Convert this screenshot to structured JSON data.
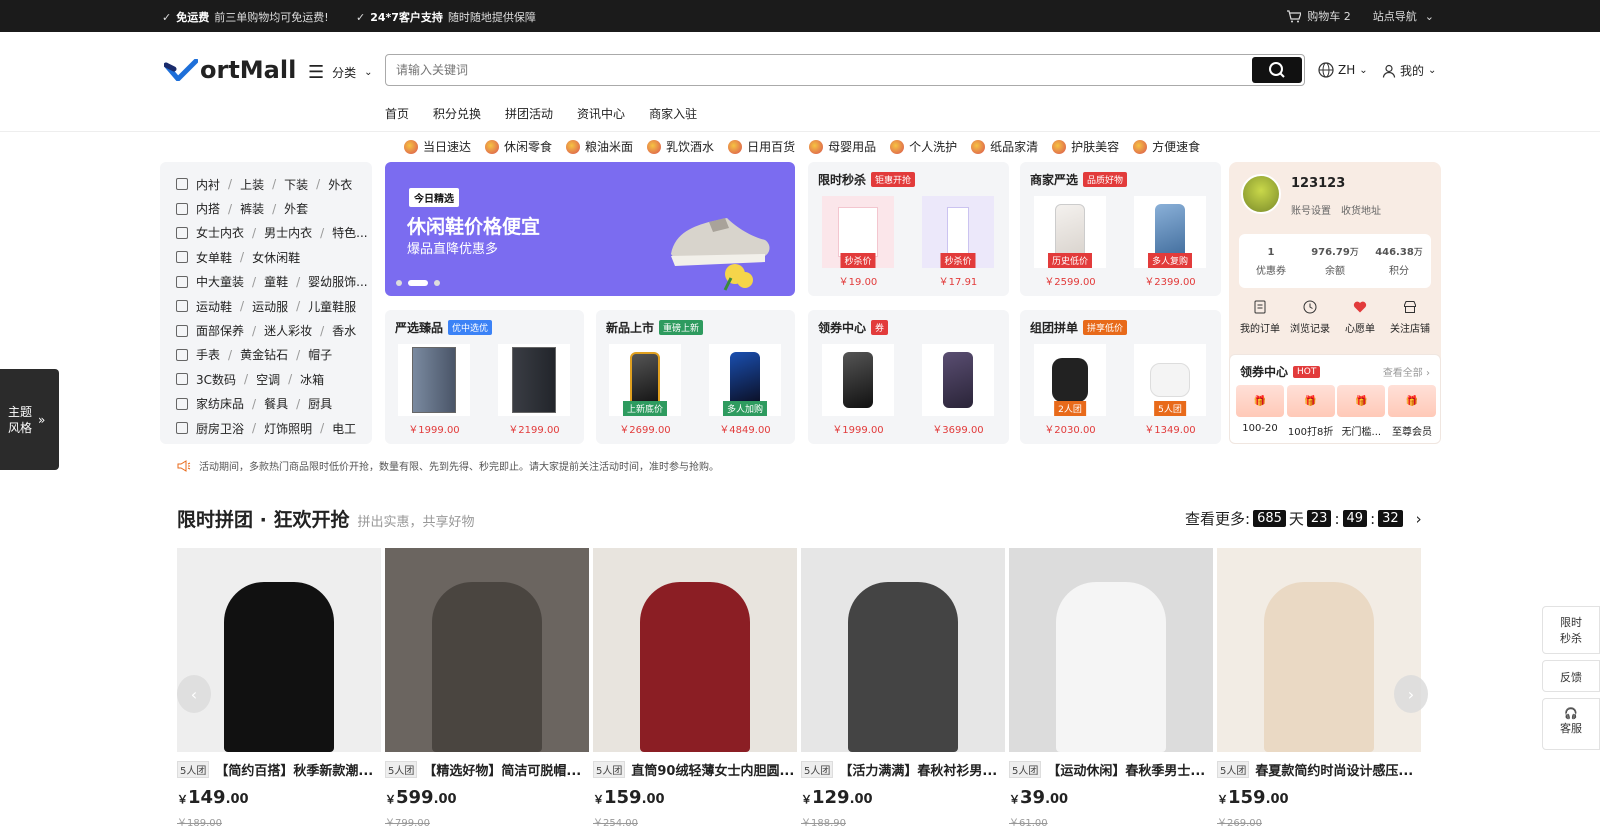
{
  "topbar": {
    "promo1_title": "免运费",
    "promo1_text": "前三单购物均可免运费!",
    "promo2_title": "24*7客户支持",
    "promo2_text": "随时随地提供保障",
    "cart": "购物车 2",
    "site_nav": "站点导航"
  },
  "header": {
    "logo": "ortMall",
    "category": "分类",
    "search_placeholder": "请输入关键词",
    "lang": "ZH",
    "mine": "我的",
    "nav": [
      "首页",
      "积分兑换",
      "拼团活动",
      "资讯中心",
      "商家入驻"
    ]
  },
  "quick_cats": [
    "当日速达",
    "休闲零食",
    "粮油米面",
    "乳饮酒水",
    "日用百货",
    "母婴用品",
    "个人洗护",
    "纸品家清",
    "护肤美容",
    "方便速食"
  ],
  "left_menu": [
    [
      "内衬",
      "上装",
      "下装",
      "外衣"
    ],
    [
      "内搭",
      "裤装",
      "外套"
    ],
    [
      "女士内衣",
      "男士内衣",
      "特色..."
    ],
    [
      "女单鞋",
      "女休闲鞋"
    ],
    [
      "中大童装",
      "童鞋",
      "婴幼服饰..."
    ],
    [
      "运动鞋",
      "运动服",
      "儿童鞋服"
    ],
    [
      "面部保养",
      "迷人彩妆",
      "香水"
    ],
    [
      "手表",
      "黄金钻石",
      "帽子"
    ],
    [
      "3C数码",
      "空调",
      "冰箱"
    ],
    [
      "家纺床品",
      "餐具",
      "厨具"
    ],
    [
      "厨房卫浴",
      "灯饰照明",
      "电工"
    ]
  ],
  "banner": {
    "tag": "今日精选",
    "title": "休闲鞋价格便宜",
    "subtitle": "爆品直降优惠多"
  },
  "cards": {
    "flash": {
      "title": "限时秒杀",
      "badge": "钜惠开抢",
      "items": [
        {
          "label": "秒杀价",
          "price": "￥19.00"
        },
        {
          "label": "秒杀价",
          "price": "￥17.91"
        }
      ]
    },
    "merchant": {
      "title": "商家严选",
      "badge": "品质好物",
      "items": [
        {
          "label": "历史低价",
          "price": "￥2599.00"
        },
        {
          "label": "多人复购",
          "price": "￥2399.00"
        }
      ]
    },
    "select": {
      "title": "严选臻品",
      "badge": "优中选优",
      "items": [
        {
          "label": "",
          "price": "￥1999.00"
        },
        {
          "label": "",
          "price": "￥2199.00"
        }
      ]
    },
    "newarrival": {
      "title": "新品上市",
      "badge": "重磅上新",
      "items": [
        {
          "label": "上新底价",
          "price": "￥2699.00"
        },
        {
          "label": "多人加购",
          "price": "￥4849.00"
        }
      ]
    },
    "coupon": {
      "title": "领券中心",
      "badge": "券",
      "items": [
        {
          "label": "",
          "price": "￥1999.00"
        },
        {
          "label": "",
          "price": "￥3699.00"
        }
      ]
    },
    "group": {
      "title": "组团拼单",
      "badge": "拼享低价",
      "items": [
        {
          "label": "2人团",
          "price": "￥2030.00"
        },
        {
          "label": "5人团",
          "price": "￥1349.00"
        }
      ]
    }
  },
  "user": {
    "name": "123123",
    "account": "账号设置",
    "address": "收货地址",
    "stats": [
      {
        "v": "1",
        "u": "",
        "l": "优惠券"
      },
      {
        "v": "976.79",
        "u": "万",
        "l": "余额"
      },
      {
        "v": "446.38",
        "u": "万",
        "l": "积分"
      }
    ],
    "shortcuts": [
      "我的订单",
      "浏览记录",
      "心愿单",
      "关注店铺"
    ],
    "coupon_title": "领券中心",
    "coupon_badge": "HOT",
    "coupon_more": "查看全部 ›",
    "coupons": [
      "100-20",
      "100打8折",
      "无门槛...",
      "至尊会员"
    ]
  },
  "notice": "活动期间，多款热门商品限时低价开抢，数量有限、先到先得、秒完即止。请大家提前关注活动时间，准时参与抢购。",
  "theme": {
    "line1": "主题",
    "line2": "风格"
  },
  "section": {
    "title": "限时拼团 · 狂欢开抢",
    "subtitle": "拼出实惠，共享好物",
    "more": "查看更多:",
    "days": "685",
    "day_unit": "天",
    "hours": "23",
    "minutes": "49",
    "seconds": "32"
  },
  "goods": [
    {
      "tag": "5人团",
      "name": "【简约百搭】秋季新款潮...",
      "price": "149",
      "cents": ".00",
      "old": "￥189.00"
    },
    {
      "tag": "5人团",
      "name": "【精选好物】简洁可脱帽...",
      "price": "599",
      "cents": ".00",
      "old": "￥799.00"
    },
    {
      "tag": "5人团",
      "name": "直筒90绒轻薄女士内胆圆...",
      "price": "159",
      "cents": ".00",
      "old": "￥254.00"
    },
    {
      "tag": "5人团",
      "name": "【活力满满】春秋衬衫男...",
      "price": "129",
      "cents": ".00",
      "old": "￥188.90"
    },
    {
      "tag": "5人团",
      "name": "【运动休闲】春秋季男士...",
      "price": "39",
      "cents": ".00",
      "old": "￥61.00"
    },
    {
      "tag": "5人团",
      "name": "春夏款简约时尚设计感压...",
      "price": "159",
      "cents": ".00",
      "old": "￥269.00"
    }
  ],
  "float_right": [
    "限时秒杀",
    "反馈",
    "客服"
  ],
  "currency": "￥"
}
